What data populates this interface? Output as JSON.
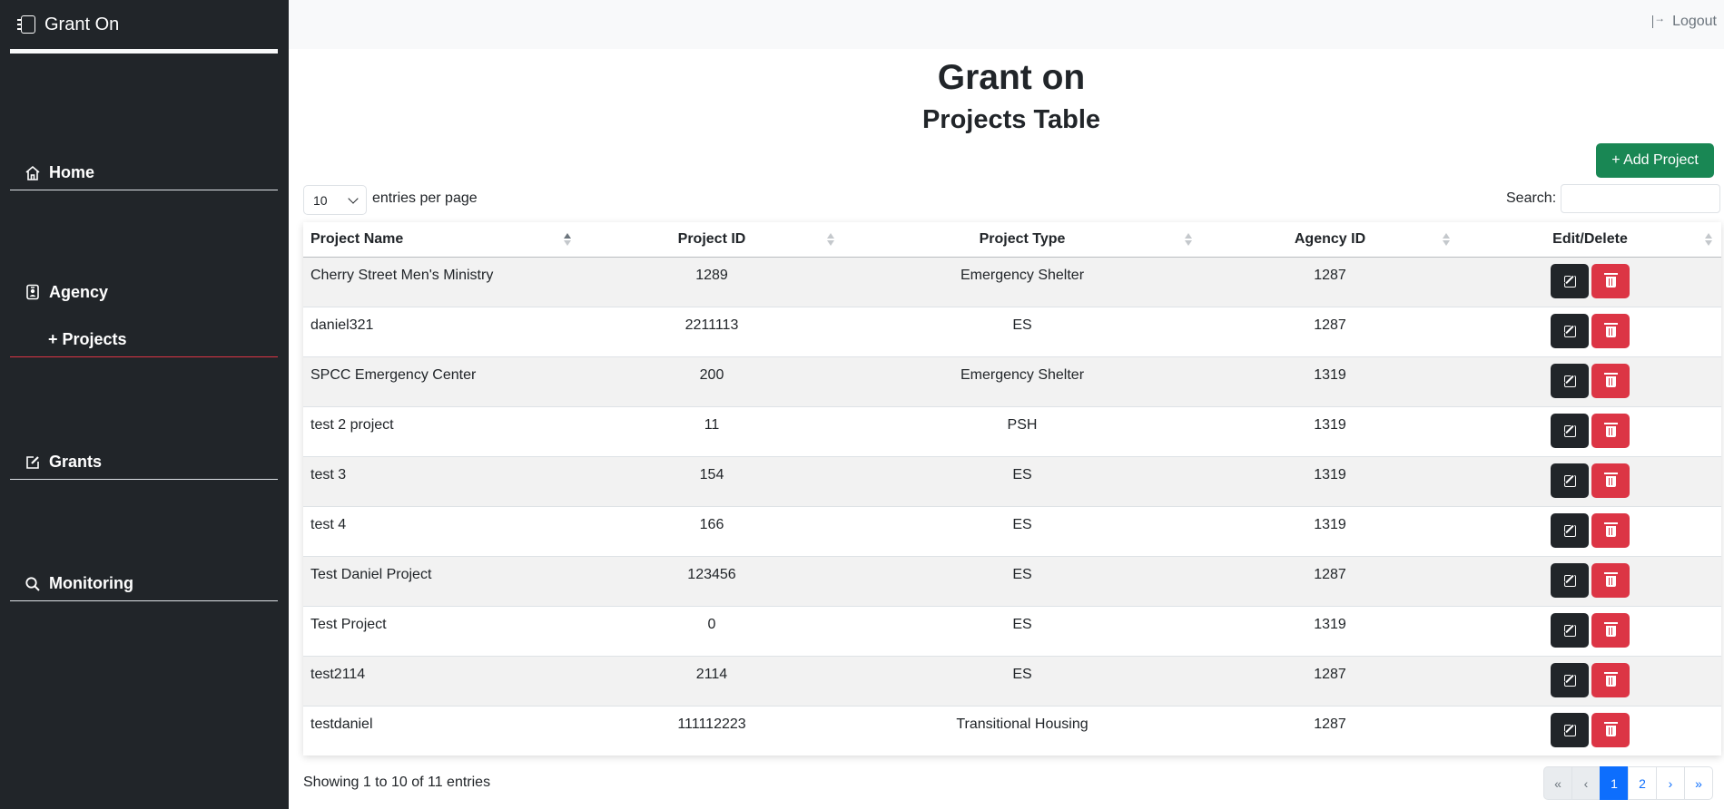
{
  "app": {
    "brand": "Grant On",
    "logout": "Logout"
  },
  "sidebar": {
    "home": "Home",
    "agency": "Agency",
    "projects": "+ Projects",
    "grants": "Grants",
    "monitoring": "Monitoring"
  },
  "page": {
    "title": "Grant on",
    "subtitle": "Projects Table"
  },
  "toolbar": {
    "add_label": "+ Add Project",
    "entries_value": "10",
    "entries_label": "entries per page",
    "search_label": "Search:"
  },
  "table": {
    "columns": [
      "Project Name",
      "Project ID",
      "Project Type",
      "Agency ID",
      "Edit/Delete"
    ],
    "rows": [
      {
        "name": "Cherry Street Men's Ministry",
        "id": "1289",
        "type": "Emergency Shelter",
        "agency": "1287"
      },
      {
        "name": "daniel321",
        "id": "2211113",
        "type": "ES",
        "agency": "1287"
      },
      {
        "name": "SPCC Emergency Center",
        "id": "200",
        "type": "Emergency Shelter",
        "agency": "1319"
      },
      {
        "name": "test 2 project",
        "id": "11",
        "type": "PSH",
        "agency": "1319"
      },
      {
        "name": "test 3",
        "id": "154",
        "type": "ES",
        "agency": "1319"
      },
      {
        "name": "test 4",
        "id": "166",
        "type": "ES",
        "agency": "1319"
      },
      {
        "name": "Test Daniel Project",
        "id": "123456",
        "type": "ES",
        "agency": "1287"
      },
      {
        "name": "Test Project",
        "id": "0",
        "type": "ES",
        "agency": "1319"
      },
      {
        "name": "test2114",
        "id": "2114",
        "type": "ES",
        "agency": "1287"
      },
      {
        "name": "testdaniel",
        "id": "111112223",
        "type": "Transitional Housing",
        "agency": "1287"
      }
    ]
  },
  "footer": {
    "info": "Showing 1 to 10 of 11 entries",
    "pager": [
      "«",
      "‹",
      "1",
      "2",
      "›",
      "»"
    ]
  }
}
